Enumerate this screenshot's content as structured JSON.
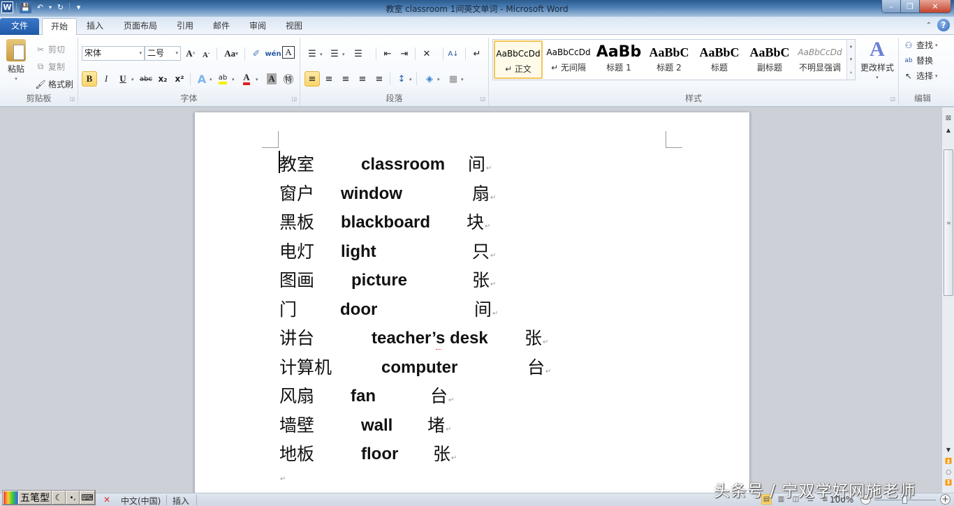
{
  "window": {
    "title": "教室    classroom   1间英文单词  -  Microsoft Word",
    "minimize": "–",
    "restore": "❐",
    "close": "✕"
  },
  "quick_access": {
    "app_icon": "W",
    "save_icon": "💾",
    "undo_icon": "↶",
    "redo_icon": "↻",
    "customize_icon": "▾"
  },
  "tabs": [
    {
      "label": "文件"
    },
    {
      "label": "开始",
      "active": true
    },
    {
      "label": "插入"
    },
    {
      "label": "页面布局"
    },
    {
      "label": "引用"
    },
    {
      "label": "邮件"
    },
    {
      "label": "审阅"
    },
    {
      "label": "视图"
    }
  ],
  "ribbon": {
    "clipboard": {
      "label": "剪贴板",
      "paste": "粘贴",
      "cut": "剪切",
      "copy": "复制",
      "format_painter": "格式刷"
    },
    "font": {
      "label": "字体",
      "font_name": "宋体",
      "font_size": "二号",
      "grow": "A",
      "shrink": "A",
      "change_case": "Aa",
      "clear_format": "✐",
      "phonetic": "wén",
      "char_border": "A",
      "bold": "B",
      "italic": "I",
      "underline": "U",
      "strikethrough": "abc",
      "subscript": "x₂",
      "superscript": "x²",
      "text_effect": "A",
      "highlight": "ab",
      "font_color": "A",
      "char_shading": "A",
      "enclose": "㊕",
      "highlight_color": "#f5f000",
      "font_color_value": "#e02020"
    },
    "paragraph": {
      "label": "段落",
      "bullets": "☰",
      "numbering": "☰",
      "multilevel": "☰",
      "decrease_indent": "⇤",
      "increase_indent": "⇥",
      "chinese_layout": "✕",
      "sort": "A↓",
      "show_marks": "↵",
      "align_left": "≡",
      "center": "≡",
      "align_right": "≡",
      "justify": "≡",
      "distributed": "≡",
      "line_spacing": "↕",
      "shading": "◈",
      "borders": "▦"
    },
    "styles": {
      "label": "样式",
      "items": [
        {
          "preview": "AaBbCcDd",
          "name": "↵ 正文",
          "selected": true
        },
        {
          "preview": "AaBbCcDd",
          "name": "↵ 无间隔"
        },
        {
          "preview": "AaBb",
          "name": "标题 1"
        },
        {
          "preview": "AaBbC",
          "name": "标题 2"
        },
        {
          "preview": "AaBbC",
          "name": "标题"
        },
        {
          "preview": "AaBbC",
          "name": "副标题"
        },
        {
          "preview": "AaBbCcDd",
          "name": "不明显强调"
        }
      ],
      "change_styles": "更改样式"
    },
    "editing": {
      "label": "编辑",
      "find": "查找",
      "replace": "替换",
      "select": "选择"
    }
  },
  "document": {
    "lines": [
      {
        "cn": "教室",
        "en": "classroom",
        "measure": "间"
      },
      {
        "cn": "窗户",
        "en": "window",
        "measure": "扇"
      },
      {
        "cn": "黑板",
        "en": "blackboard",
        "measure": "块"
      },
      {
        "cn": "电灯",
        "en": "light",
        "measure": "只"
      },
      {
        "cn": "图画",
        "en": "picture",
        "measure": "张"
      },
      {
        "cn": "门",
        "en": "door",
        "measure": "间"
      },
      {
        "cn": "讲台",
        "en": "teacher’s desk",
        "measure": "张"
      },
      {
        "cn": "计算机",
        "en": "computer",
        "measure": "台"
      },
      {
        "cn": "风扇",
        "en": "fan",
        "measure": "台"
      },
      {
        "cn": "墙壁",
        "en": "wall",
        "measure": "堵"
      },
      {
        "cn": "地板",
        "en": "floor",
        "measure": "张"
      }
    ],
    "paragraph_mark": "↵"
  },
  "statusbar": {
    "ime": [
      "五笔型",
      "☾",
      "•,",
      "⌨"
    ],
    "language": "中文(中国)",
    "mode": "插入",
    "zoom": "100%"
  },
  "watermark": "头条号 / 宁双学好网施老师"
}
